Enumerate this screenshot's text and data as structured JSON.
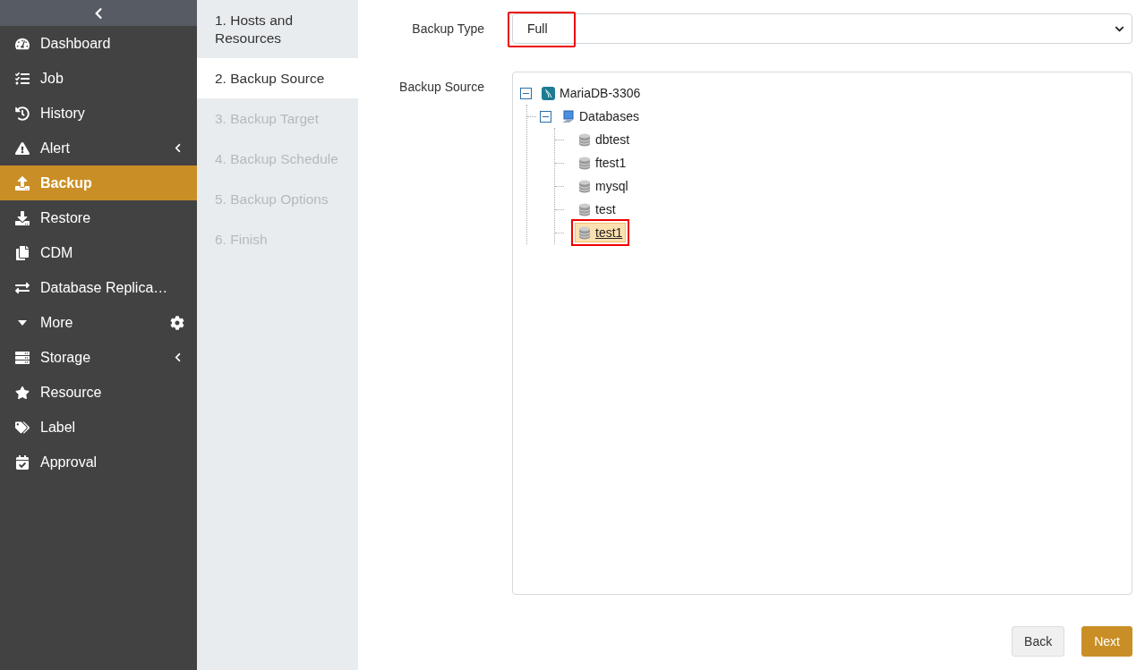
{
  "sidebar": {
    "items": [
      {
        "label": "Dashboard",
        "selected": false
      },
      {
        "label": "Job",
        "selected": false
      },
      {
        "label": "History",
        "selected": false
      },
      {
        "label": "Alert",
        "selected": false
      },
      {
        "label": "Backup",
        "selected": true
      },
      {
        "label": "Restore",
        "selected": false
      },
      {
        "label": "CDM",
        "selected": false
      },
      {
        "label": "Database Replica…",
        "selected": false
      },
      {
        "label": "More",
        "selected": false
      },
      {
        "label": "Storage",
        "selected": false
      },
      {
        "label": "Resource",
        "selected": false
      },
      {
        "label": "Label",
        "selected": false
      },
      {
        "label": "Approval",
        "selected": false
      }
    ]
  },
  "steps": [
    {
      "label": "1. Hosts and Resources",
      "disabled": false,
      "selected": false
    },
    {
      "label": "2. Backup Source",
      "disabled": false,
      "selected": true
    },
    {
      "label": "3. Backup Target",
      "disabled": true,
      "selected": false
    },
    {
      "label": "4. Backup Schedule",
      "disabled": true,
      "selected": false
    },
    {
      "label": "5. Backup Options",
      "disabled": true,
      "selected": false
    },
    {
      "label": "6. Finish",
      "disabled": true,
      "selected": false
    }
  ],
  "form": {
    "backup_type": {
      "label": "Backup Type",
      "value": "Full",
      "highlighted": true
    },
    "backup_source": {
      "label": "Backup Source",
      "tree": [
        {
          "label": "MariaDB-3306",
          "kind": "instance",
          "expanded": true,
          "selected": false,
          "highlighted": false,
          "children": [
            {
              "label": "Databases",
              "kind": "group",
              "expanded": true,
              "selected": false,
              "highlighted": false,
              "children": [
                {
                  "label": "dbtest",
                  "kind": "database",
                  "selected": false,
                  "highlighted": false
                },
                {
                  "label": "ftest1",
                  "kind": "database",
                  "selected": false,
                  "highlighted": false
                },
                {
                  "label": "mysql",
                  "kind": "database",
                  "selected": false,
                  "highlighted": false
                },
                {
                  "label": "test",
                  "kind": "database",
                  "selected": false,
                  "highlighted": false
                },
                {
                  "label": "test1",
                  "kind": "database",
                  "selected": true,
                  "highlighted": true
                }
              ]
            }
          ]
        }
      ]
    }
  },
  "buttons": [
    {
      "label": "Back",
      "kind": "secondary"
    },
    {
      "label": "Next",
      "kind": "primary"
    }
  ]
}
